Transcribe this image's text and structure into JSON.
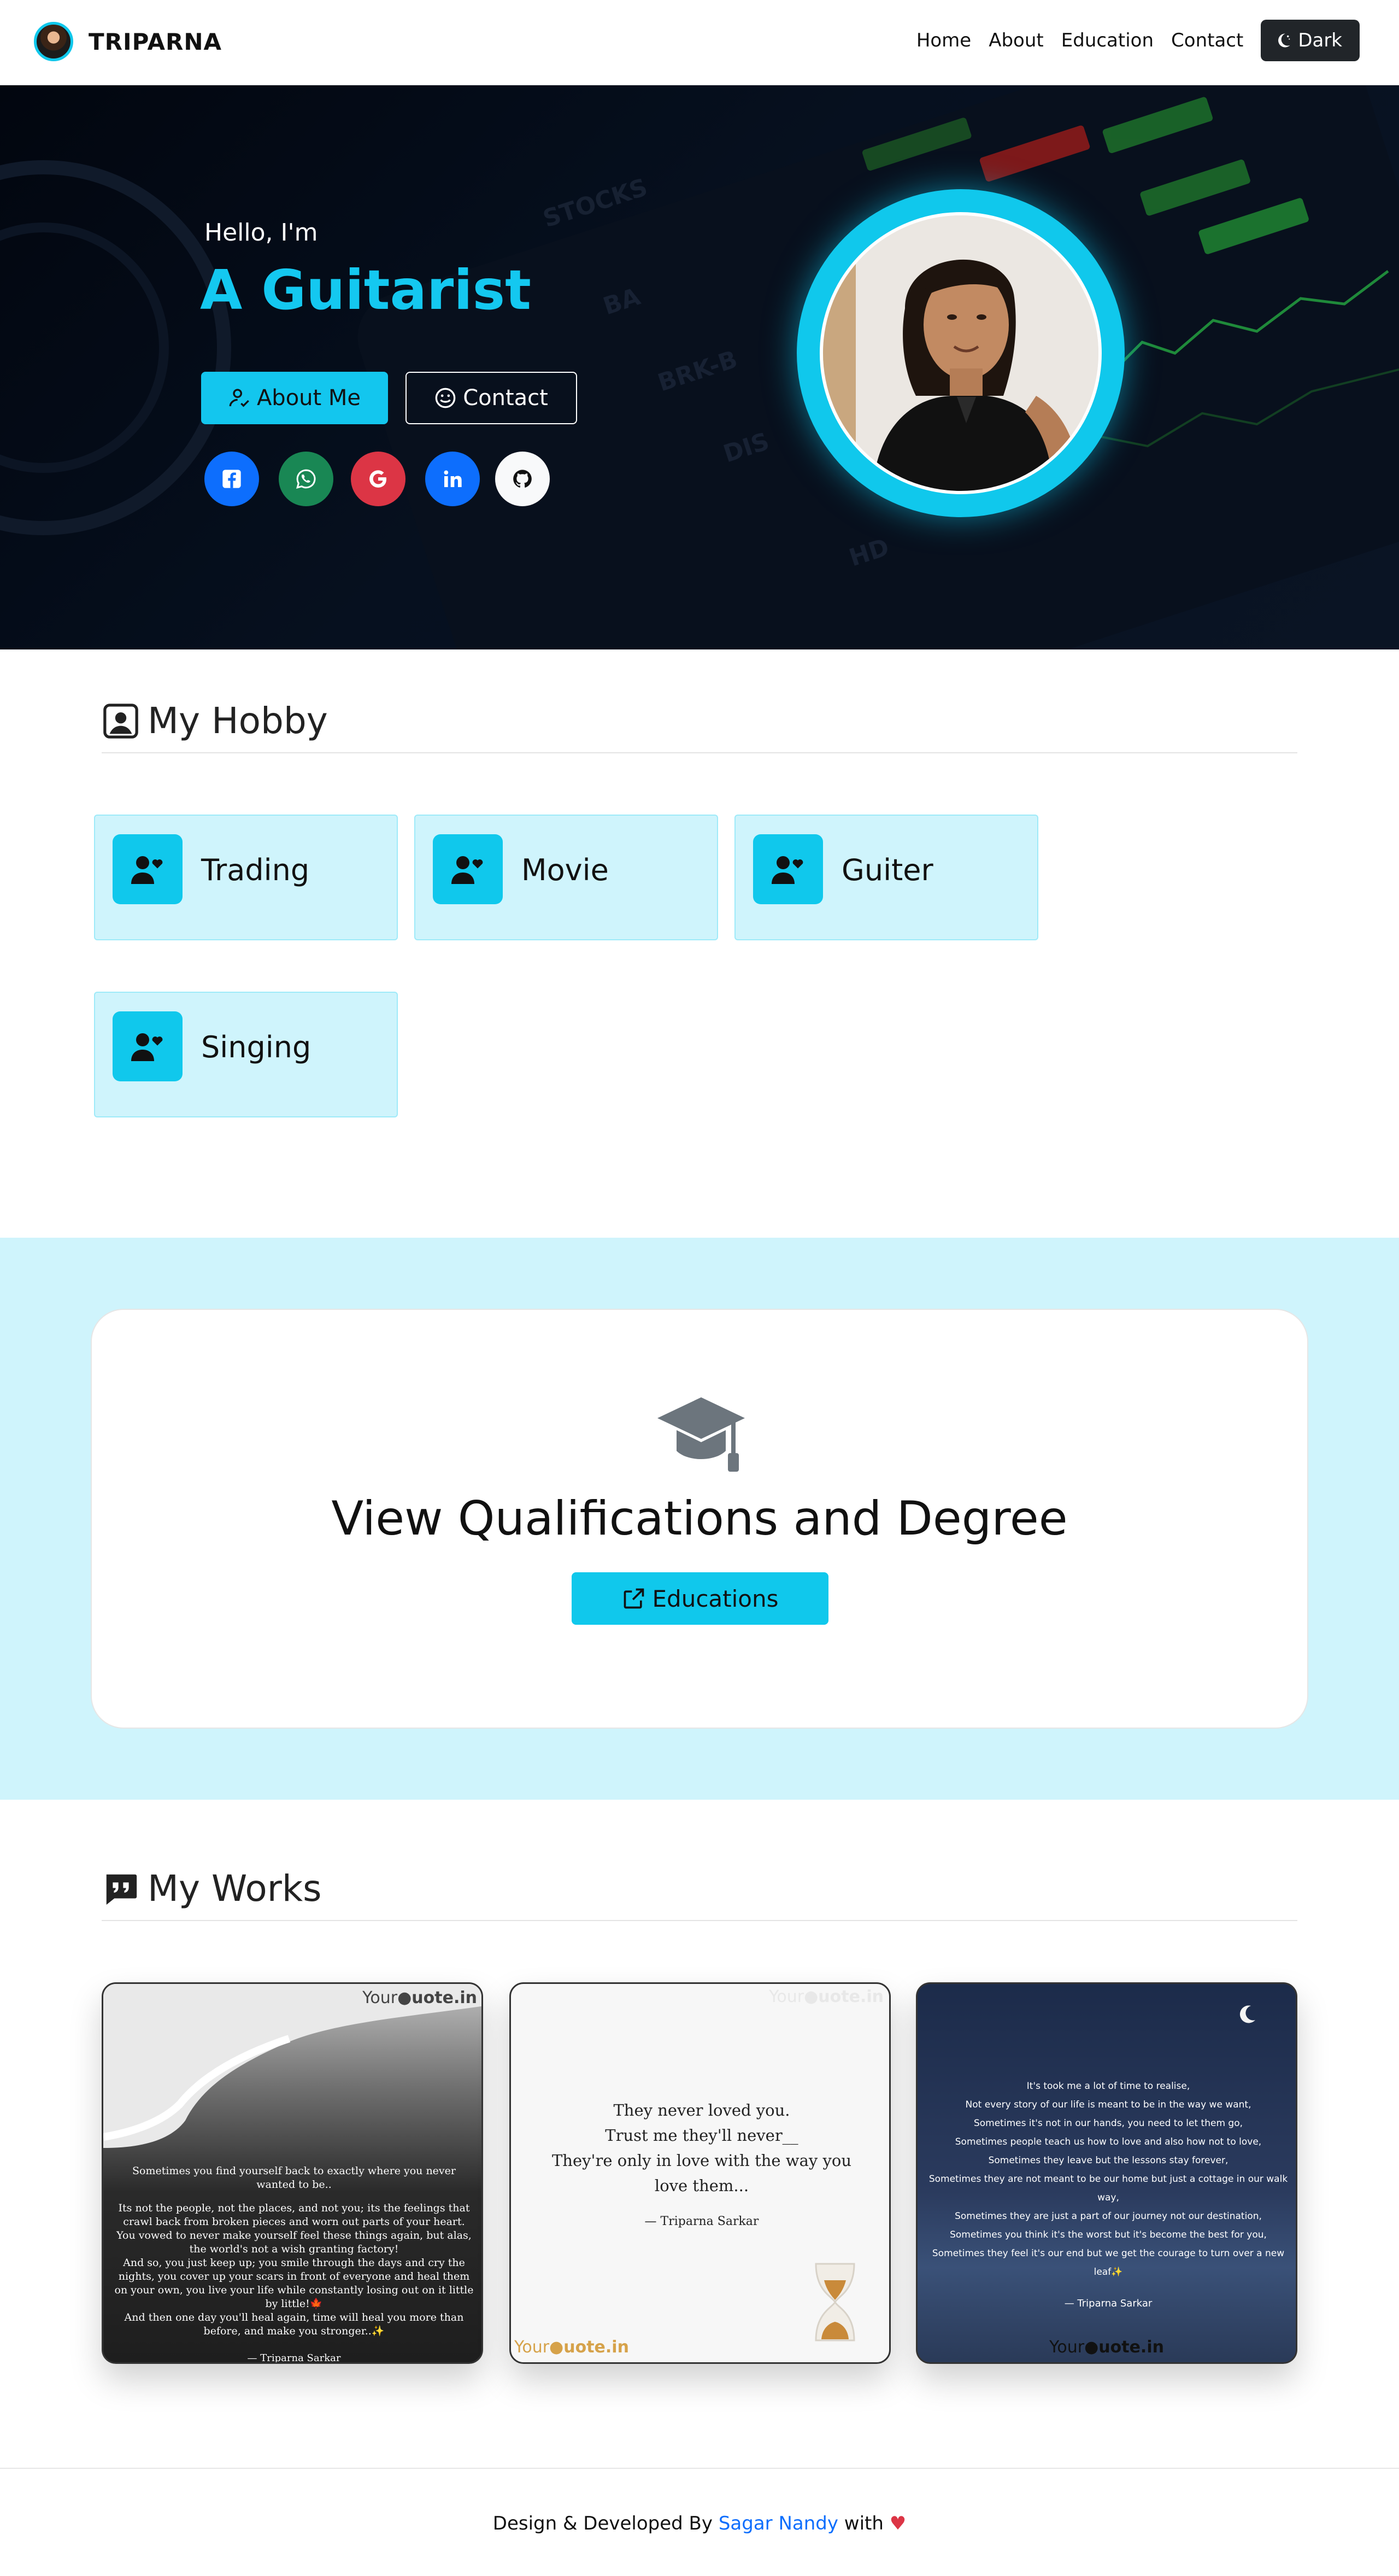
{
  "nav": {
    "brand": "TRIPARNA",
    "links": [
      "Home",
      "About",
      "Education",
      "Contact"
    ],
    "theme_toggle": "Dark"
  },
  "hero": {
    "greeting": "Hello, I'm",
    "role": "A Guitarist",
    "about_button": "About Me",
    "contact_button": "Contact",
    "socials": [
      {
        "icon": "facebook-icon",
        "color": "#0d6efd"
      },
      {
        "icon": "whatsapp-icon",
        "color": "#198754"
      },
      {
        "icon": "google-icon",
        "color": "#dc3545"
      },
      {
        "icon": "linkedin-icon",
        "color": "#0d6efd"
      },
      {
        "icon": "github-icon",
        "color": "#f8f9fa"
      }
    ],
    "accent": "#10c8ec"
  },
  "hobby": {
    "title": "My Hobby",
    "items": [
      "Trading",
      "Movie",
      "Guiter",
      "Singing"
    ]
  },
  "education": {
    "heading": "View Qualifications and Degree",
    "button": "Educations"
  },
  "works": {
    "title": "My Works",
    "cards": [
      {
        "watermark_a": "Your",
        "watermark_b": "uote.in",
        "lines": [
          "Sometimes you find yourself back to exactly where you never wanted to be..",
          "Its not the people, not the places, and not you; its the feelings that crawl back from broken pieces and worn out parts of your heart.",
          "You vowed to never make yourself feel these things again, but alas, the world's not a wish granting factory!",
          "And so, you just keep up; you smile through the days and cry the nights, you cover up your scars in front of everyone and heal them on your own, you live your life while constantly losing out on it little by little!🍁",
          "And then one day you'll heal again, time will heal you more than before, and make you stronger..✨"
        ],
        "author": "— Triparna Sarkar"
      },
      {
        "watermark_a": "Your",
        "watermark_b": "uote.in",
        "lines": [
          "They never loved you.",
          "Trust me they'll never__",
          "They're only in love with the way you love them..."
        ],
        "author": "— Triparna Sarkar"
      },
      {
        "watermark_a": "Your",
        "watermark_b": "uote.in",
        "lines": [
          "It's took me a lot of time to realise,",
          "Not every story of our life is meant to be in the way we want,",
          "Sometimes it's not in our hands, you need to let them go,",
          "Sometimes  people teach us how to love and also how not to love,",
          "Sometimes they leave but the lessons stay forever,",
          "Sometimes they are not meant to be our home but just a cottage in our walk way,",
          "Sometimes they are just a part of our journey not our destination,",
          "Sometimes you think it's the worst but it's become the best for you,",
          "Sometimes they feel it's our end but we get the courage to turn over a new leaf✨"
        ],
        "author": "— Triparna Sarkar"
      }
    ]
  },
  "footer": {
    "prefix": "Design & Developed By",
    "author": "Sagar Nandy",
    "suffix": "with"
  }
}
